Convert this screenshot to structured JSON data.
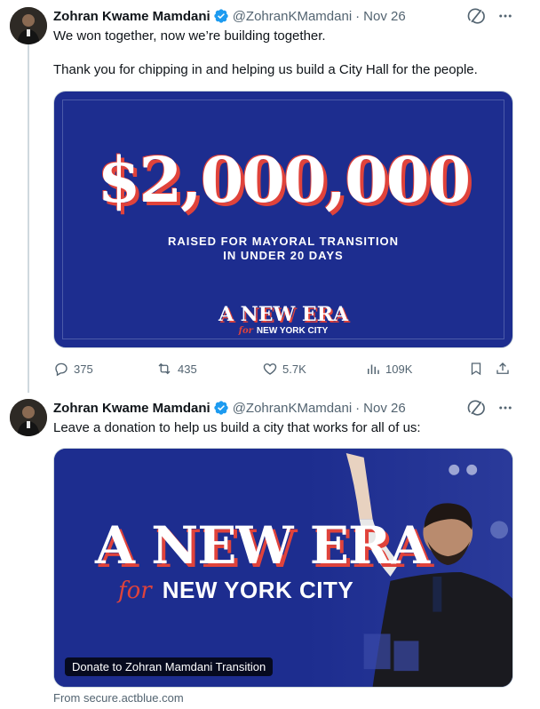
{
  "tweets": [
    {
      "author_name": "Zohran Kwame Mamdani",
      "handle": "@ZohranKMamdani",
      "separator": "·",
      "date": "Nov 26",
      "text_lines": [
        "We won together, now we’re building together.",
        "Thank you for chipping in and helping us build a City Hall for the people."
      ],
      "image": {
        "amount": "$2,000,000",
        "subtitle_line1": "RAISED FOR MAYORAL TRANSITION",
        "subtitle_line2": "IN UNDER 20 DAYS",
        "era_title": "A NEW ERA",
        "era_for": "for",
        "era_city": "NEW YORK CITY"
      },
      "actions": {
        "replies": "375",
        "reposts": "435",
        "likes": "5.7K",
        "views": "109K"
      }
    },
    {
      "author_name": "Zohran Kwame Mamdani",
      "handle": "@ZohranKMamdani",
      "separator": "·",
      "date": "Nov 26",
      "text": "Leave a donation to help us build a city that works for all of us:",
      "card": {
        "era_title": "A NEW ERA",
        "era_for": "for",
        "era_city": "NEW YORK CITY",
        "link_title": "Donate to Zohran Mamdani Transition",
        "source": "From secure.actblue.com"
      }
    }
  ],
  "colors": {
    "text": "#0f1419",
    "muted": "#536471",
    "verified": "#1d9bf0",
    "card_blue": "#1d2d8f",
    "accent_red": "#e0433b"
  },
  "icons": [
    "verified-icon",
    "grok-icon",
    "more-icon",
    "reply-icon",
    "repost-icon",
    "like-icon",
    "views-icon",
    "bookmark-icon",
    "share-icon"
  ]
}
